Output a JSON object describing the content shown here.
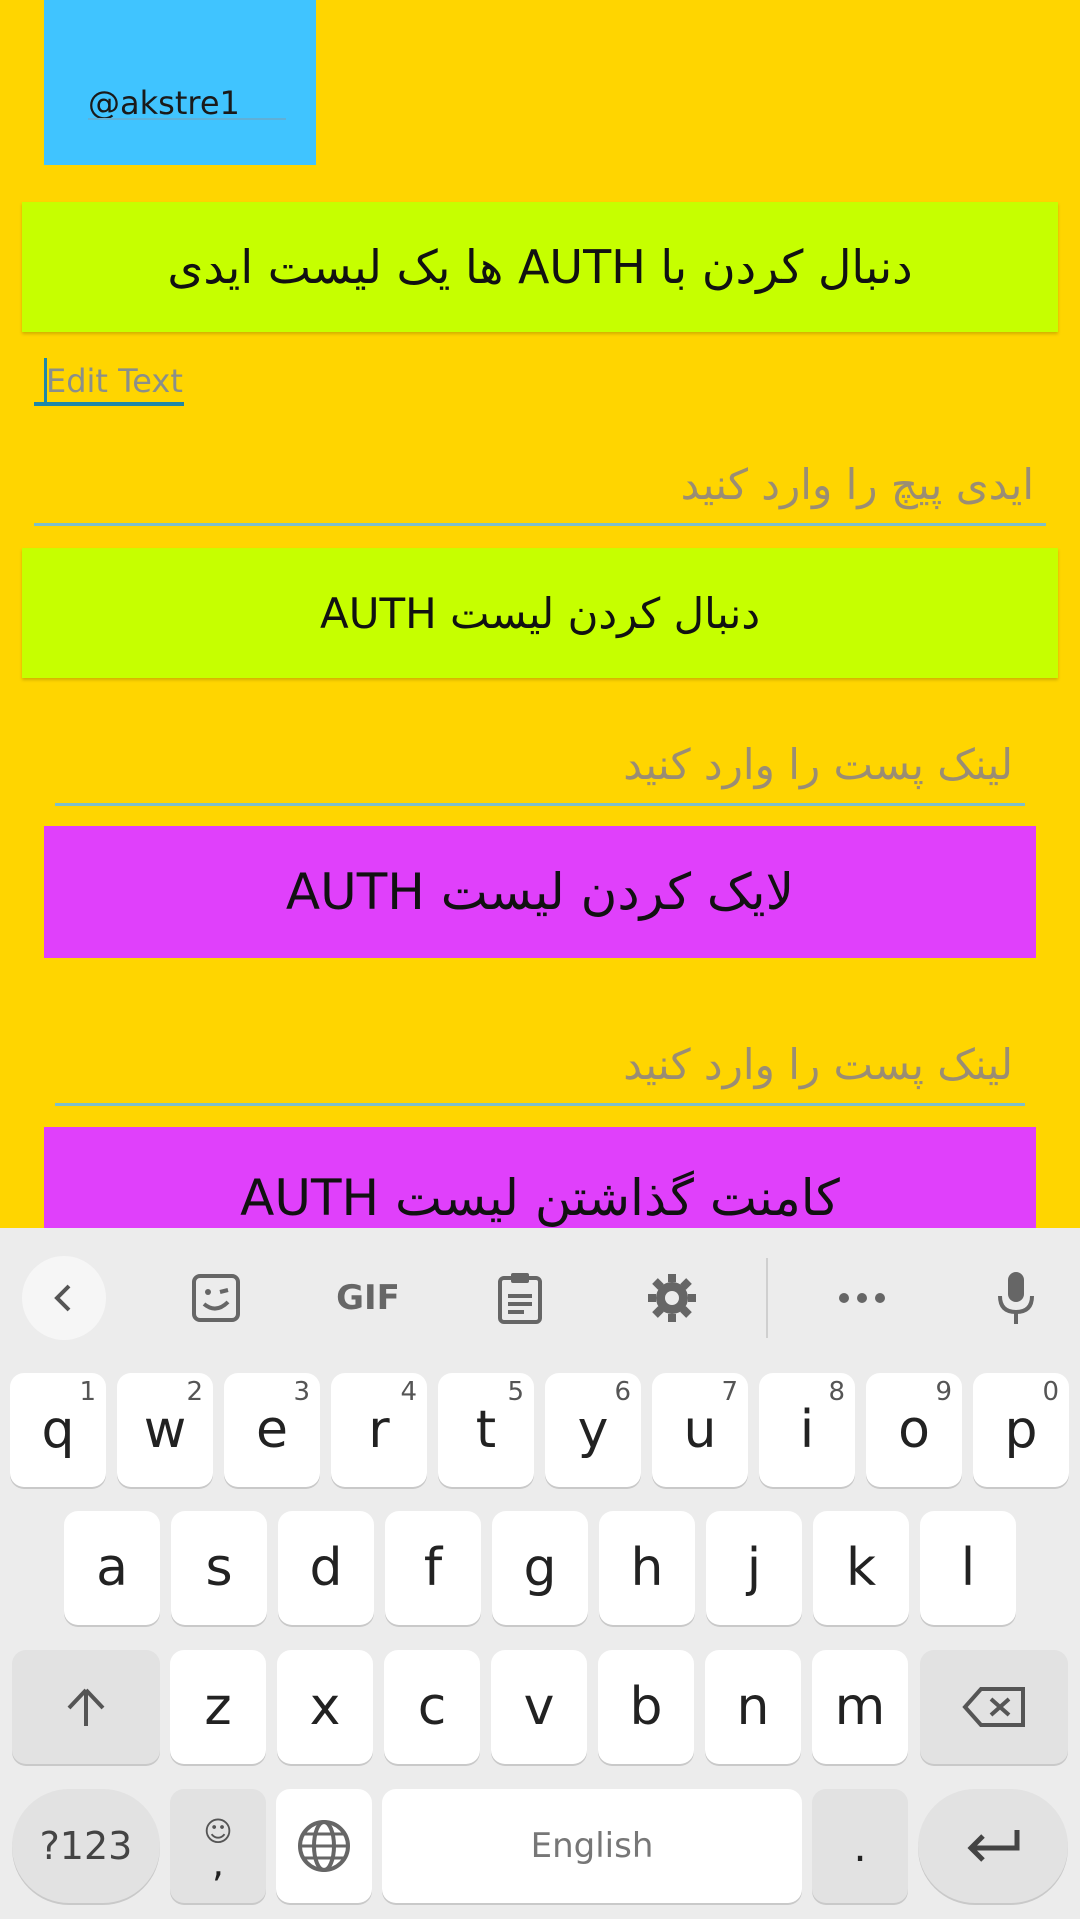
{
  "account": {
    "handle": "@akstre1"
  },
  "buttons": {
    "follow_with_list": "دنبال کردن با AUTH ها یک لیست ایدی",
    "follow_list": "دنبال کردن لیست AUTH",
    "like_list": "لایک کردن لیست AUTH",
    "comment_list": "کامنت گذاشتن لیست AUTH"
  },
  "inputs": {
    "edit_text_placeholder": "Edit Text",
    "page_id_placeholder": "ایدی پیچ را وارد کنید",
    "post_link_placeholder_1": "لینک پست را وارد کنید",
    "post_link_placeholder_2": "لینک پست را وارد کنید"
  },
  "colors": {
    "background": "#FFD500",
    "account_box": "#40C4FF",
    "green_button": "#C6FF00",
    "magenta_button": "#E040FB"
  },
  "keyboard": {
    "toolbar": [
      "back-icon",
      "sticker-icon",
      "GIF",
      "clipboard-icon",
      "gear-icon",
      "more-icon",
      "mic-icon"
    ],
    "toolbar_gif_label": "GIF",
    "row1": [
      {
        "k": "q",
        "h": "1"
      },
      {
        "k": "w",
        "h": "2"
      },
      {
        "k": "e",
        "h": "3"
      },
      {
        "k": "r",
        "h": "4"
      },
      {
        "k": "t",
        "h": "5"
      },
      {
        "k": "y",
        "h": "6"
      },
      {
        "k": "u",
        "h": "7"
      },
      {
        "k": "i",
        "h": "8"
      },
      {
        "k": "o",
        "h": "9"
      },
      {
        "k": "p",
        "h": "0"
      }
    ],
    "row2": [
      "a",
      "s",
      "d",
      "f",
      "g",
      "h",
      "j",
      "k",
      "l"
    ],
    "row3": [
      "z",
      "x",
      "c",
      "v",
      "b",
      "n",
      "m"
    ],
    "symbols_label": "?123",
    "emoji_comma": ",",
    "space_label": "English",
    "period_label": "."
  }
}
